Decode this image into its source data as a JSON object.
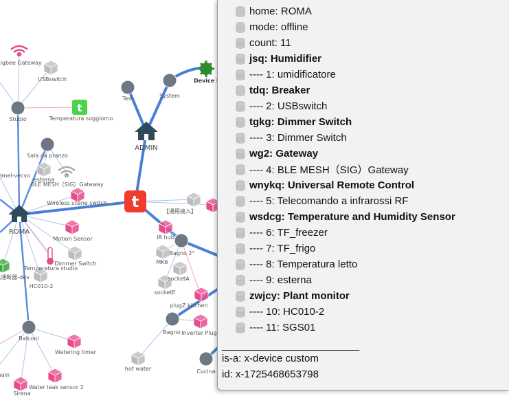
{
  "graph": {
    "hubs": {
      "roma": "ROMA",
      "admin": "ADMIN",
      "studio": "Studio",
      "sala_pranzo": "Sala da pranzo",
      "balconi": "Balconi",
      "test": "Test",
      "system": "System",
      "bagno_2": "Bagno 2°",
      "bagno": "Bagno",
      "cucina": "Cucina"
    },
    "labels": {
      "zigbee_gateway": "Zigbee Gateway",
      "usbswitch": "USBswitch",
      "temperatura_soggiorno": "Temperatura soggiorno",
      "device_list": "Device lis",
      "panel_vecchio": "Panel-vecvo",
      "esterna": "esterna",
      "ble_mesh_gateway": "BLE MESH（SIG）Gateway",
      "wireless_scene_switch": "Wireless scene switch",
      "motion_sensor": "Motion Sensor",
      "dimmer_switch": "Dimmer Switch",
      "temperatura_studio": "Temperatura studio",
      "hc010_2": "HC010-2",
      "watering_timer": "Watering timer",
      "water_leak_sensor_2": "Water leak sensor 2",
      "sirena": "Sirena",
      "main": "main",
      "hot_water": "hot water",
      "ir_hub": "IR hub",
      "mk6": "MK6",
      "socketa": "socketA",
      "sockete": "socketE",
      "plugz_kitchen": "plugZ kitchen",
      "inverter_plug": "Inverter Plug",
      "zhongwen": "【通用接入】",
      "guangtong": "光通断器-dev"
    }
  },
  "panel": {
    "rows": [
      {
        "text": "home: ROMA",
        "bold": false
      },
      {
        "text": "mode: offline",
        "bold": false
      },
      {
        "text": "count: 11",
        "bold": false
      },
      {
        "text": "jsq: Humidifier",
        "bold": true
      },
      {
        "text": "---- 1: umidificatore",
        "bold": false
      },
      {
        "text": "tdq: Breaker",
        "bold": true
      },
      {
        "text": "---- 2: USBswitch",
        "bold": false
      },
      {
        "text": "tgkg: Dimmer Switch",
        "bold": true
      },
      {
        "text": "---- 3: Dimmer Switch",
        "bold": false
      },
      {
        "text": "wg2: Gateway",
        "bold": true
      },
      {
        "text": "---- 4: BLE MESH（SIG）Gateway",
        "bold": false
      },
      {
        "text": "wnykq: Universal Remote Control",
        "bold": true
      },
      {
        "text": "---- 5: Telecomando a infrarossi RF",
        "bold": false
      },
      {
        "text": "wsdcg: Temperature and Humidity Sensor",
        "bold": true
      },
      {
        "text": "---- 6: TF_freezer",
        "bold": false
      },
      {
        "text": "---- 7: TF_frigo",
        "bold": false
      },
      {
        "text": "---- 8: Temperatura letto",
        "bold": false
      },
      {
        "text": "---- 9: esterna",
        "bold": false
      },
      {
        "text": "zwjcy: Plant monitor",
        "bold": true
      },
      {
        "text": "---- 10: HC010-2",
        "bold": false
      },
      {
        "text": "---- 11: SGS01",
        "bold": false
      }
    ],
    "separator": "________________________",
    "is_a": "is-a: x-device custom",
    "id": "id: x-1725468653798"
  }
}
